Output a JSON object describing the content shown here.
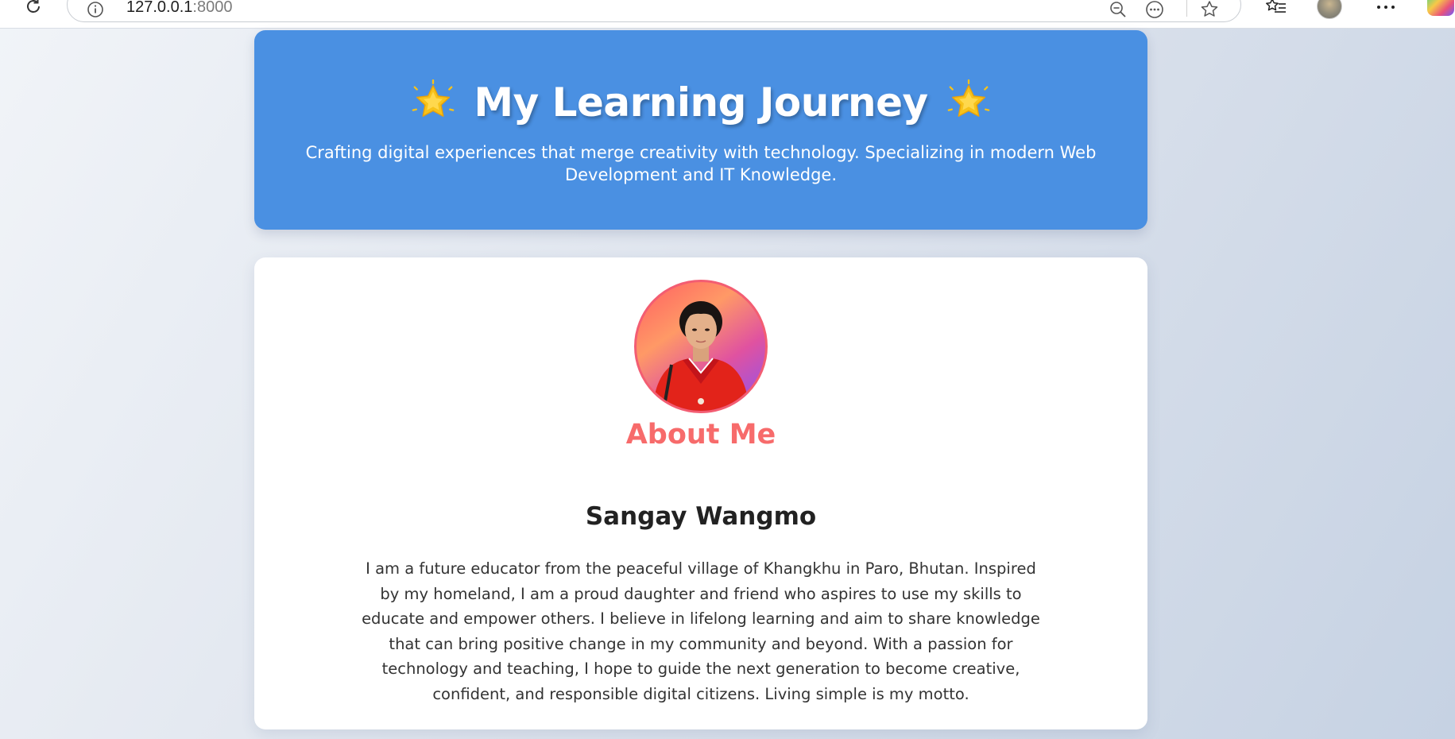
{
  "browser": {
    "url_host": "127.0.0.1",
    "url_port": ":8000",
    "icons": [
      "reload-icon",
      "info-icon",
      "zoom-out-icon",
      "read-aloud-icon",
      "favorite-star-icon",
      "favorites-list-icon",
      "profile-avatar",
      "more-menu-icon",
      "copilot-icon"
    ]
  },
  "hero": {
    "title": "My Learning Journey",
    "star": "glowing-star-icon",
    "subtitle": "Crafting digital experiences that merge creativity with technology. Specializing in modern Web Development and IT Knowledge.",
    "background": "#4a90e2"
  },
  "about": {
    "heading": "About Me",
    "heading_color": "#f76b6b",
    "name": "Sangay Wangmo",
    "bio": "I am a future educator from the peaceful village of Khangkhu in Paro, Bhutan. Inspired by my homeland, I am a proud daughter and friend who aspires to use my skills to educate and empower others. I believe in lifelong learning and aim to share knowledge that can bring positive change in my community and beyond. With a passion for technology and teaching, I hope to guide the next generation to become creative, confident, and responsible digital citizens. Living simple is my motto."
  }
}
